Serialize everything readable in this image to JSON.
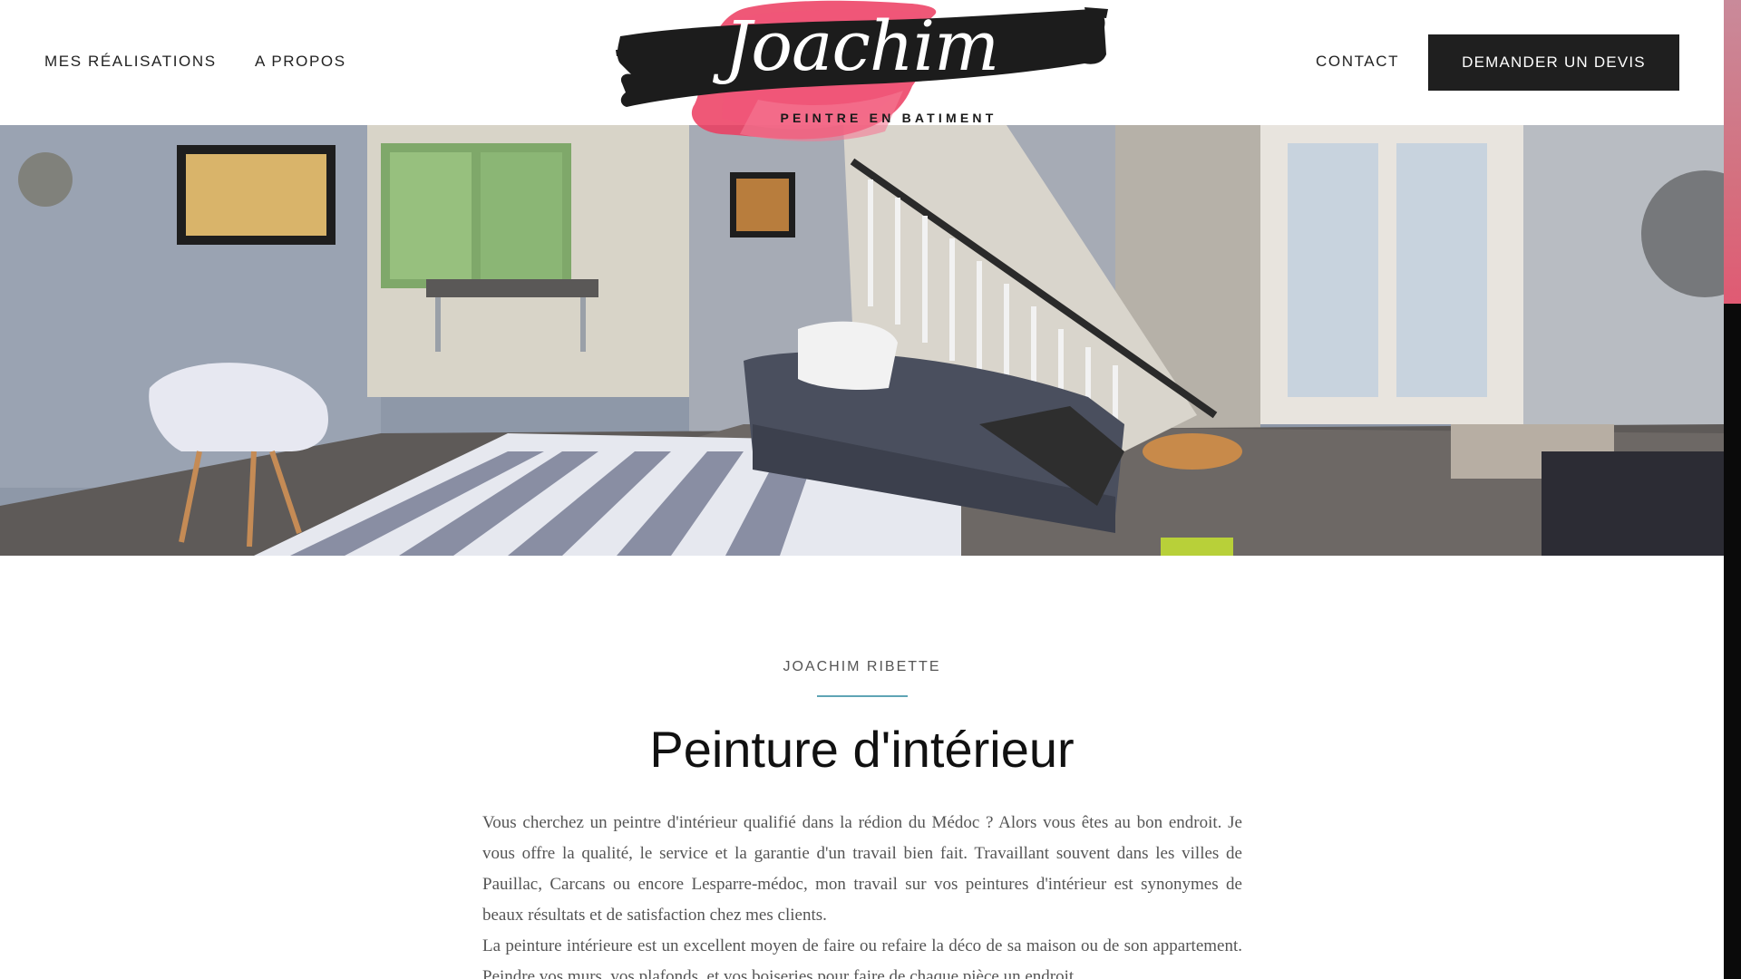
{
  "nav": {
    "left_items": [
      "MES RÉALISATIONS",
      "A PROPOS"
    ],
    "contact_label": "CONTACT",
    "cta_label": "DEMANDER UN DEVIS"
  },
  "logo": {
    "name": "Joachim",
    "tagline": "PEINTRE EN BATIMENT"
  },
  "hero": {
    "image": "interior-living-room-photo"
  },
  "section": {
    "eyebrow": "JOACHIM RIBETTE",
    "title": "Peinture d'intérieur",
    "paragraphs": [
      "Vous cherchez un peintre d'intérieur qualifié dans la rédion du Médoc ? Alors vous êtes au bon endroit. Je vous offre la qualité, le service et la garantie d'un travail bien fait. Travaillant souvent dans les villes de Pauillac, Carcans ou encore Lesparre-médoc, mon travail sur vos peintures d'intérieur est synonymes de beaux résultats et de satisfaction chez mes clients.",
      "La peinture intérieure est un excellent moyen de faire ou refaire la déco de sa maison ou de son appartement. Peindre vos murs, vos plafonds, et vos boiseries pour faire de chaque pièce un endroit"
    ]
  },
  "colors": {
    "accent_pink": "#e8365a",
    "dark": "#1f1f1f",
    "divider_teal": "#5fa4b5"
  }
}
